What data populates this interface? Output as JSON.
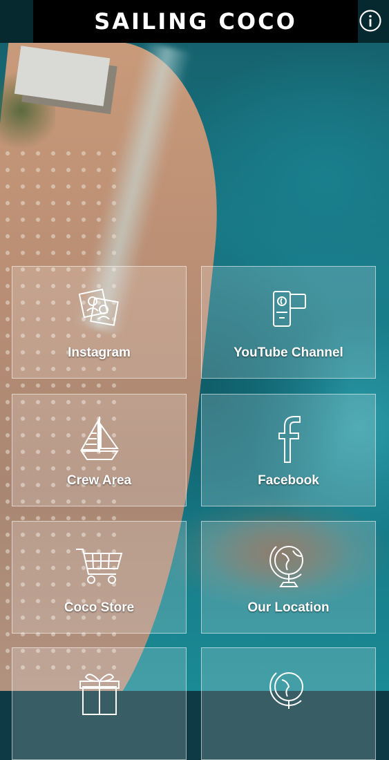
{
  "app": {
    "title": "SAILING COCO"
  },
  "header": {
    "info_icon": "info-icon"
  },
  "tiles": [
    {
      "label": "Instagram",
      "icon": "photos-icon"
    },
    {
      "label": "YouTube Channel",
      "icon": "video-camera-icon"
    },
    {
      "label": "Crew Area",
      "icon": "sailboat-icon"
    },
    {
      "label": "Facebook",
      "icon": "facebook-icon"
    },
    {
      "label": "Coco Store",
      "icon": "shopping-cart-icon"
    },
    {
      "label": "Our Location",
      "icon": "globe-icon"
    },
    {
      "label": "",
      "icon": "gift-icon"
    },
    {
      "label": "",
      "icon": "globe-icon"
    }
  ],
  "colors": {
    "header_bg": "#000000",
    "tile_border": "#ffffff",
    "text": "#ffffff"
  }
}
